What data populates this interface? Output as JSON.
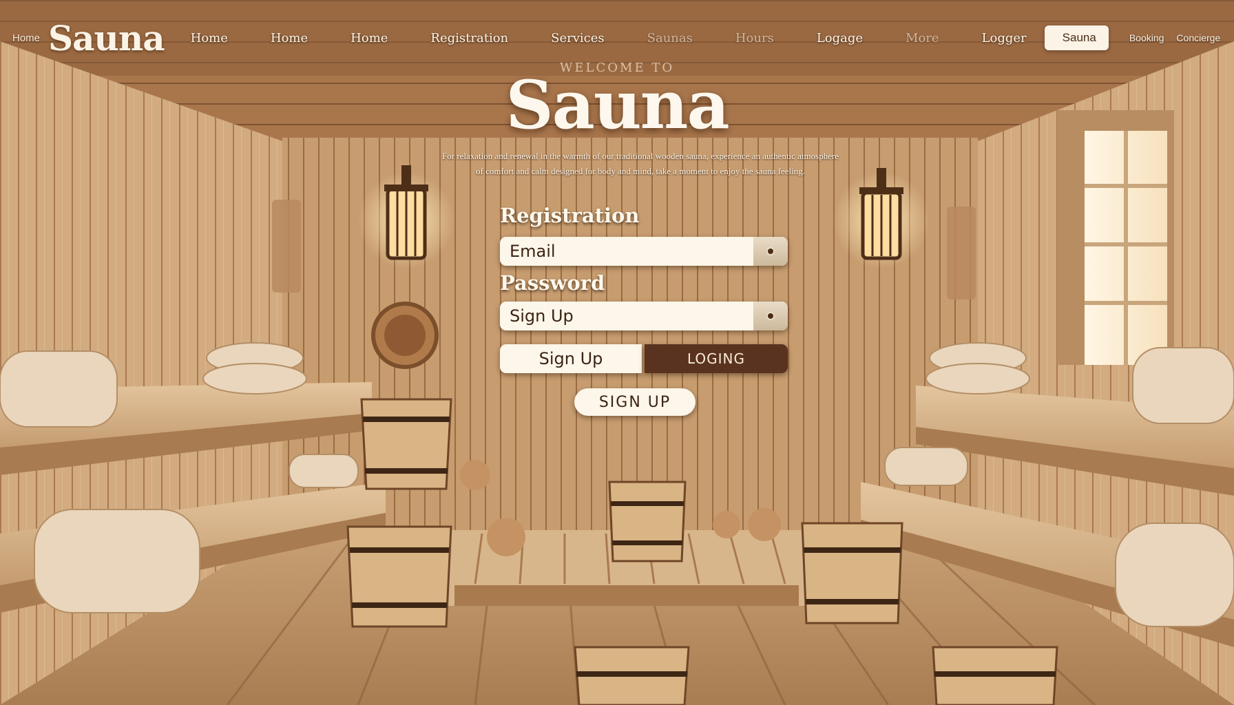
{
  "nav": {
    "home_small": "Home",
    "brand": "Sauna",
    "items": [
      "Home",
      "Home",
      "Home",
      "Registration",
      "Services",
      "Saunas",
      "Hours",
      "Logage",
      "More",
      "Logger"
    ],
    "pill": "Sauna",
    "right_items": [
      "Booking",
      "Concierge"
    ]
  },
  "hero": {
    "welcome": "WELCOME TO",
    "title": "Sauna",
    "description": "For relaxation and renewal in the warmth of our traditional wooden sauna, experience an authentic atmosphere of comfort and calm designed for body and mind, take a moment to enjoy the sauna feeling."
  },
  "form": {
    "heading": "Registration",
    "email_placeholder": "Email",
    "password_label": "Password",
    "password_placeholder": "Sign Up",
    "signup_button": "Sign Up",
    "login_button": "LOGING",
    "submit_button": "SIGN UP"
  },
  "colors": {
    "wood_light": "#d9b88e",
    "wood_dark": "#8a5a36",
    "cream": "#fdf6ea",
    "brown_button": "#5a3320"
  }
}
